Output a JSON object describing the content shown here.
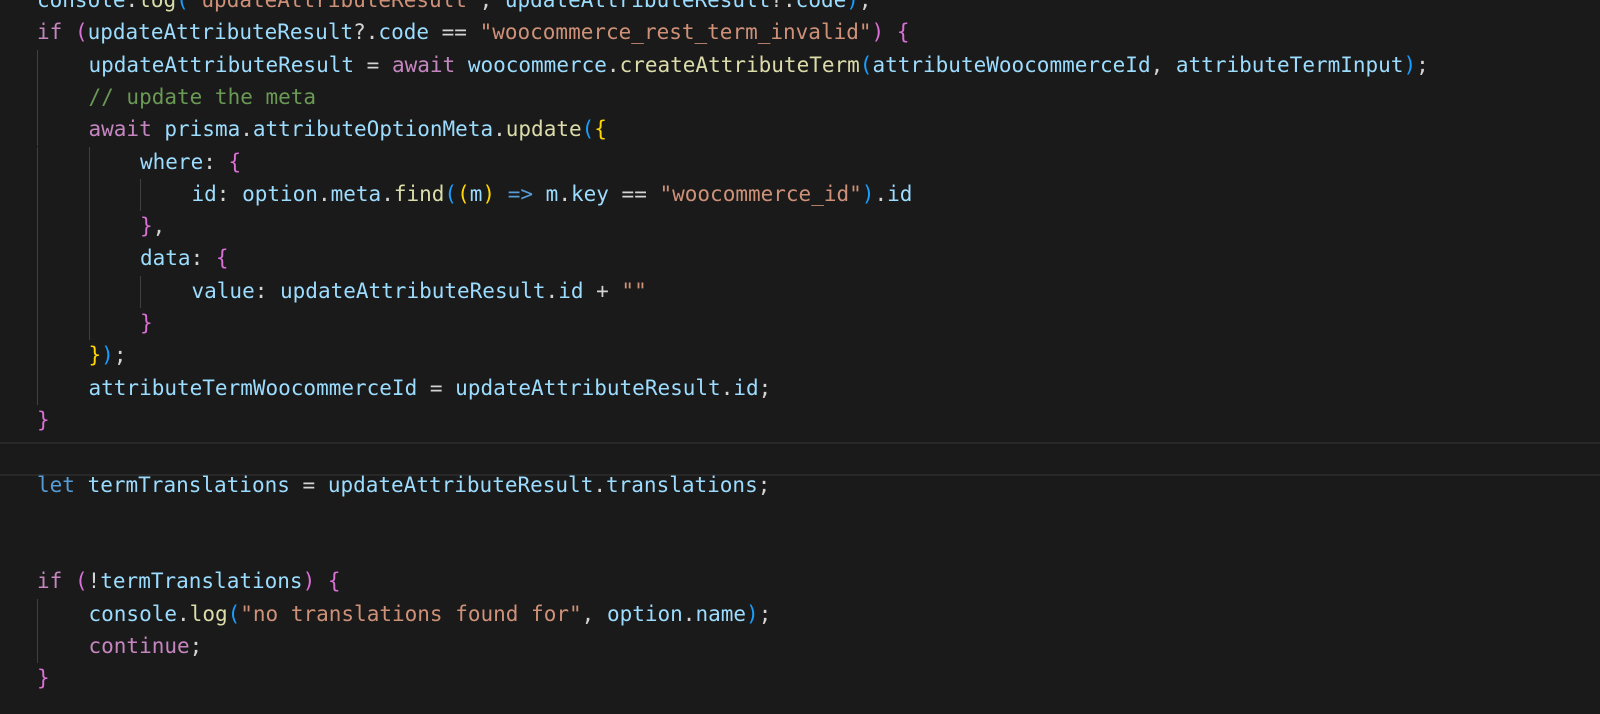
{
  "colors": {
    "background": "#1a1a1a",
    "control_keyword": "#c586c0",
    "keyword": "#569cd6",
    "variable": "#9cdcfe",
    "function": "#dcdcaa",
    "string": "#ce9178",
    "comment": "#6a9955",
    "punctuation": "#d4d4d4",
    "bracket_level_1": "#ffd700",
    "bracket_level_2": "#da70d6",
    "bracket_level_3": "#179fff"
  },
  "code_lines": [
    {
      "indent": 0,
      "tokens": [
        {
          "t": "console",
          "c": "var"
        },
        {
          "t": ".",
          "c": "punc"
        },
        {
          "t": "log",
          "c": "fn"
        },
        {
          "t": "(",
          "c": "br3"
        },
        {
          "t": "\"updateAttributeResult\"",
          "c": "str"
        },
        {
          "t": ", ",
          "c": "punc"
        },
        {
          "t": "updateAttributeResult",
          "c": "var"
        },
        {
          "t": "?.",
          "c": "punc"
        },
        {
          "t": "code",
          "c": "var"
        },
        {
          "t": ")",
          "c": "br3"
        },
        {
          "t": ";",
          "c": "punc"
        }
      ]
    },
    {
      "indent": 0,
      "tokens": [
        {
          "t": "if",
          "c": "kw-ctrl"
        },
        {
          "t": " ",
          "c": "punc"
        },
        {
          "t": "(",
          "c": "br2"
        },
        {
          "t": "updateAttributeResult",
          "c": "var"
        },
        {
          "t": "?.",
          "c": "punc"
        },
        {
          "t": "code",
          "c": "var"
        },
        {
          "t": " == ",
          "c": "punc"
        },
        {
          "t": "\"woocommerce_rest_term_invalid\"",
          "c": "str"
        },
        {
          "t": ")",
          "c": "br2"
        },
        {
          "t": " ",
          "c": "punc"
        },
        {
          "t": "{",
          "c": "br2"
        }
      ]
    },
    {
      "indent": 1,
      "tokens": [
        {
          "t": "updateAttributeResult",
          "c": "var"
        },
        {
          "t": " = ",
          "c": "punc"
        },
        {
          "t": "await",
          "c": "kw-ctrl"
        },
        {
          "t": " ",
          "c": "punc"
        },
        {
          "t": "woocommerce",
          "c": "var"
        },
        {
          "t": ".",
          "c": "punc"
        },
        {
          "t": "createAttributeTerm",
          "c": "fn"
        },
        {
          "t": "(",
          "c": "br3"
        },
        {
          "t": "attributeWoocommerceId",
          "c": "var"
        },
        {
          "t": ", ",
          "c": "punc"
        },
        {
          "t": "attributeTermInput",
          "c": "var"
        },
        {
          "t": ")",
          "c": "br3"
        },
        {
          "t": ";",
          "c": "punc"
        }
      ]
    },
    {
      "indent": 1,
      "tokens": [
        {
          "t": "// update the meta",
          "c": "cmt"
        }
      ]
    },
    {
      "indent": 1,
      "tokens": [
        {
          "t": "await",
          "c": "kw-ctrl"
        },
        {
          "t": " ",
          "c": "punc"
        },
        {
          "t": "prisma",
          "c": "var"
        },
        {
          "t": ".",
          "c": "punc"
        },
        {
          "t": "attributeOptionMeta",
          "c": "var"
        },
        {
          "t": ".",
          "c": "punc"
        },
        {
          "t": "update",
          "c": "fn"
        },
        {
          "t": "(",
          "c": "br3"
        },
        {
          "t": "{",
          "c": "br1"
        }
      ]
    },
    {
      "indent": 2,
      "tokens": [
        {
          "t": "where",
          "c": "var"
        },
        {
          "t": ": ",
          "c": "punc"
        },
        {
          "t": "{",
          "c": "br2"
        }
      ]
    },
    {
      "indent": 3,
      "tokens": [
        {
          "t": "id",
          "c": "var"
        },
        {
          "t": ": ",
          "c": "punc"
        },
        {
          "t": "option",
          "c": "var"
        },
        {
          "t": ".",
          "c": "punc"
        },
        {
          "t": "meta",
          "c": "var"
        },
        {
          "t": ".",
          "c": "punc"
        },
        {
          "t": "find",
          "c": "fn"
        },
        {
          "t": "(",
          "c": "br3"
        },
        {
          "t": "(",
          "c": "br1"
        },
        {
          "t": "m",
          "c": "var"
        },
        {
          "t": ")",
          "c": "br1"
        },
        {
          "t": " ",
          "c": "punc"
        },
        {
          "t": "=>",
          "c": "kw"
        },
        {
          "t": " ",
          "c": "punc"
        },
        {
          "t": "m",
          "c": "var"
        },
        {
          "t": ".",
          "c": "punc"
        },
        {
          "t": "key",
          "c": "var"
        },
        {
          "t": " == ",
          "c": "punc"
        },
        {
          "t": "\"woocommerce_id\"",
          "c": "str"
        },
        {
          "t": ")",
          "c": "br3"
        },
        {
          "t": ".",
          "c": "punc"
        },
        {
          "t": "id",
          "c": "var"
        }
      ]
    },
    {
      "indent": 2,
      "tokens": [
        {
          "t": "}",
          "c": "br2"
        },
        {
          "t": ",",
          "c": "punc"
        }
      ]
    },
    {
      "indent": 2,
      "tokens": [
        {
          "t": "data",
          "c": "var"
        },
        {
          "t": ": ",
          "c": "punc"
        },
        {
          "t": "{",
          "c": "br2"
        }
      ]
    },
    {
      "indent": 3,
      "tokens": [
        {
          "t": "value",
          "c": "var"
        },
        {
          "t": ": ",
          "c": "punc"
        },
        {
          "t": "updateAttributeResult",
          "c": "var"
        },
        {
          "t": ".",
          "c": "punc"
        },
        {
          "t": "id",
          "c": "var"
        },
        {
          "t": " + ",
          "c": "punc"
        },
        {
          "t": "\"\"",
          "c": "str"
        }
      ]
    },
    {
      "indent": 2,
      "tokens": [
        {
          "t": "}",
          "c": "br2"
        }
      ]
    },
    {
      "indent": 1,
      "tokens": [
        {
          "t": "}",
          "c": "br1"
        },
        {
          "t": ")",
          "c": "br3"
        },
        {
          "t": ";",
          "c": "punc"
        }
      ]
    },
    {
      "indent": 1,
      "tokens": [
        {
          "t": "attributeTermWoocommerceId",
          "c": "var"
        },
        {
          "t": " = ",
          "c": "punc"
        },
        {
          "t": "updateAttributeResult",
          "c": "var"
        },
        {
          "t": ".",
          "c": "punc"
        },
        {
          "t": "id",
          "c": "var"
        },
        {
          "t": ";",
          "c": "punc"
        }
      ]
    },
    {
      "indent": 0,
      "tokens": [
        {
          "t": "}",
          "c": "br2"
        }
      ]
    },
    {
      "indent": 0,
      "tokens": []
    },
    {
      "indent": 0,
      "tokens": [
        {
          "t": "let",
          "c": "kw"
        },
        {
          "t": " ",
          "c": "punc"
        },
        {
          "t": "termTranslations",
          "c": "var"
        },
        {
          "t": " = ",
          "c": "punc"
        },
        {
          "t": "updateAttributeResult",
          "c": "var"
        },
        {
          "t": ".",
          "c": "punc"
        },
        {
          "t": "translations",
          "c": "var"
        },
        {
          "t": ";",
          "c": "punc"
        }
      ]
    },
    {
      "indent": 0,
      "tokens": []
    },
    {
      "indent": 0,
      "tokens": []
    },
    {
      "indent": 0,
      "tokens": [
        {
          "t": "if",
          "c": "kw-ctrl"
        },
        {
          "t": " ",
          "c": "punc"
        },
        {
          "t": "(",
          "c": "br2"
        },
        {
          "t": "!",
          "c": "punc"
        },
        {
          "t": "termTranslations",
          "c": "var"
        },
        {
          "t": ")",
          "c": "br2"
        },
        {
          "t": " ",
          "c": "punc"
        },
        {
          "t": "{",
          "c": "br2"
        }
      ]
    },
    {
      "indent": 1,
      "tokens": [
        {
          "t": "console",
          "c": "var"
        },
        {
          "t": ".",
          "c": "punc"
        },
        {
          "t": "log",
          "c": "fn"
        },
        {
          "t": "(",
          "c": "br3"
        },
        {
          "t": "\"no translations found for\"",
          "c": "str"
        },
        {
          "t": ", ",
          "c": "punc"
        },
        {
          "t": "option",
          "c": "var"
        },
        {
          "t": ".",
          "c": "punc"
        },
        {
          "t": "name",
          "c": "var"
        },
        {
          "t": ")",
          "c": "br3"
        },
        {
          "t": ";",
          "c": "punc"
        }
      ]
    },
    {
      "indent": 1,
      "tokens": [
        {
          "t": "continue",
          "c": "kw-ctrl"
        },
        {
          "t": ";",
          "c": "punc"
        }
      ]
    },
    {
      "indent": 0,
      "tokens": [
        {
          "t": "}",
          "c": "br2"
        }
      ]
    }
  ]
}
